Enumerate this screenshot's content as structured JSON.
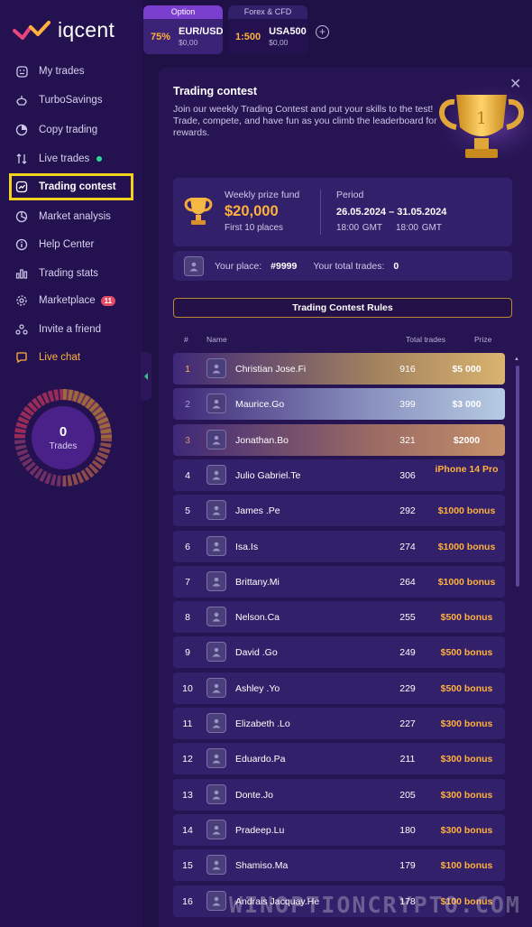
{
  "brand": {
    "logo_text": "iqcent"
  },
  "topbar": {
    "tabs": [
      {
        "header": "Option",
        "pct": "75%",
        "symbol": "EUR/USD",
        "amount": "$0,00"
      },
      {
        "header": "Forex & CFD",
        "pct": "1:500",
        "symbol": "USA500",
        "amount": "$0,00"
      }
    ],
    "add_icon": "+"
  },
  "sidebar": {
    "items": [
      {
        "label": "My trades",
        "icon": "trades-icon"
      },
      {
        "label": "TurboSavings",
        "icon": "savings-icon"
      },
      {
        "label": "Copy trading",
        "icon": "copy-icon"
      },
      {
        "label": "Live trades",
        "icon": "live-trades-icon"
      },
      {
        "label": "Trading contest",
        "icon": "contest-icon"
      },
      {
        "label": "Market analysis",
        "icon": "analysis-icon"
      },
      {
        "label": "Help Center",
        "icon": "info-icon"
      },
      {
        "label": "Trading stats",
        "icon": "stats-icon"
      },
      {
        "label": "Marketplace",
        "icon": "gear-icon",
        "badge": "11"
      },
      {
        "label": "Invite a friend",
        "icon": "invite-icon"
      },
      {
        "label": "Live chat",
        "icon": "chat-icon"
      }
    ],
    "trades_count": "0",
    "trades_label": "Trades"
  },
  "panel": {
    "title": "Trading contest",
    "description": "Join our weekly Trading Contest and put your skills to the test! Trade, compete, and have fun as you climb the leaderboard for rewards.",
    "prize_label": "Weekly prize fund",
    "prize_amount": "$20,000",
    "prize_sub": "First 10 places",
    "period_label": "Period",
    "period_dates": "26.05.2024 – 31.05.2024",
    "period_times": "18:00 GMT    18:00 GMT",
    "place_label": "Your place:",
    "place_value": "#9999",
    "total_label": "Your total trades:",
    "total_value": "0",
    "rules_button": "Trading Contest Rules",
    "columns": {
      "rank": "#",
      "name": "Name",
      "trades": "Total trades",
      "prize": "Prize"
    }
  },
  "leaderboard": [
    {
      "rank": "1",
      "name": "Christian Jose.Fi",
      "trades": "916",
      "prize": "$5 000"
    },
    {
      "rank": "2",
      "name": "Maurice.Go",
      "trades": "399",
      "prize": "$3 000"
    },
    {
      "rank": "3",
      "name": "Jonathan.Bo",
      "trades": "321",
      "prize": "$2000"
    },
    {
      "rank": "4",
      "name": "Julio Gabriel.Te",
      "trades": "306",
      "prize": "iPhone 14 Pro"
    },
    {
      "rank": "5",
      "name": "James .Pe",
      "trades": "292",
      "prize": "$1000 bonus"
    },
    {
      "rank": "6",
      "name": "Isa.Is",
      "trades": "274",
      "prize": "$1000 bonus"
    },
    {
      "rank": "7",
      "name": "Brittany.Mi",
      "trades": "264",
      "prize": "$1000 bonus"
    },
    {
      "rank": "8",
      "name": "Nelson.Ca",
      "trades": "255",
      "prize": "$500 bonus"
    },
    {
      "rank": "9",
      "name": "David .Go",
      "trades": "249",
      "prize": "$500 bonus"
    },
    {
      "rank": "10",
      "name": "Ashley .Yo",
      "trades": "229",
      "prize": "$500 bonus"
    },
    {
      "rank": "11",
      "name": "Elizabeth .Lo",
      "trades": "227",
      "prize": "$300 bonus"
    },
    {
      "rank": "12",
      "name": "Eduardo.Pa",
      "trades": "211",
      "prize": "$300 bonus"
    },
    {
      "rank": "13",
      "name": "Donte.Jo",
      "trades": "205",
      "prize": "$300 bonus"
    },
    {
      "rank": "14",
      "name": "Pradeep.Lu",
      "trades": "180",
      "prize": "$300 bonus"
    },
    {
      "rank": "15",
      "name": "Shamiso.Ma",
      "trades": "179",
      "prize": "$100 bonus"
    },
    {
      "rank": "16",
      "name": "Andrais Jacquay.He",
      "trades": "178",
      "prize": "$100 bonus"
    }
  ],
  "watermark": "WINOPTIONCRYPTO.COM",
  "colors": {
    "accent": "#ffb13d",
    "background": "#1f1146",
    "highlight": "#f2d21d"
  }
}
